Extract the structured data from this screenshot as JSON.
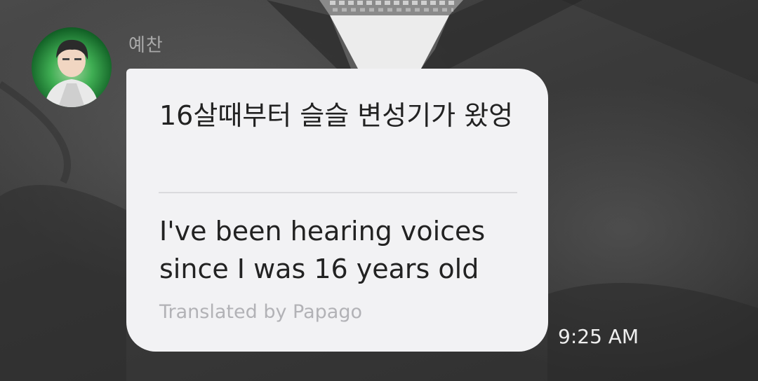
{
  "message": {
    "sender": "예찬",
    "original_text": "16살때부터 슬슬 변성기가 왔엉",
    "translated_text": "I've been hearing voices since I was 16 years old",
    "translation_credit": "Translated by Papago",
    "time": "9:25 AM"
  },
  "colors": {
    "bubble": "#f2f2f4",
    "sender_name": "#a9a9a9",
    "credit_text": "#b2b2b6",
    "time_text": "#efefef",
    "background": "#3a3a3a"
  },
  "icons": {
    "avatar": "profile-photo"
  }
}
